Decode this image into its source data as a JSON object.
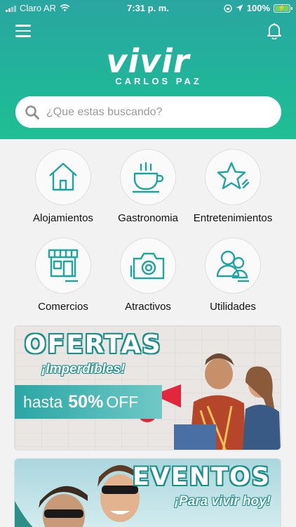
{
  "status_bar": {
    "carrier": "Claro AR",
    "time": "7:31 p. m.",
    "battery": "100%"
  },
  "header": {
    "logo_main": "vivir",
    "logo_sub": "CARLOS PAZ",
    "search_placeholder": "¿Que estas buscando?",
    "icons": {
      "menu": "hamburger-icon",
      "notifications": "bell-icon",
      "search": "search-icon"
    }
  },
  "categories": [
    {
      "label": "Alojamientos",
      "icon": "house-icon"
    },
    {
      "label": "Gastronomia",
      "icon": "coffee-cup-icon"
    },
    {
      "label": "Entretenimientos",
      "icon": "star-icon"
    },
    {
      "label": "Comercios",
      "icon": "store-icon"
    },
    {
      "label": "Atractivos",
      "icon": "camera-icon"
    },
    {
      "label": "Utilidades",
      "icon": "users-icon"
    }
  ],
  "banners": {
    "ofertas": {
      "title": "OFERTAS",
      "subtitle": "¡Imperdibles!",
      "prefix": "hasta",
      "percent": "50%",
      "suffix": "OFF"
    },
    "eventos": {
      "title": "EVENTOS",
      "subtitle": "¡Para vivir hoy!"
    }
  },
  "colors": {
    "accent": "#1fa5a0",
    "header_top": "#2aa6a0",
    "header_bottom": "#1fbf93"
  }
}
